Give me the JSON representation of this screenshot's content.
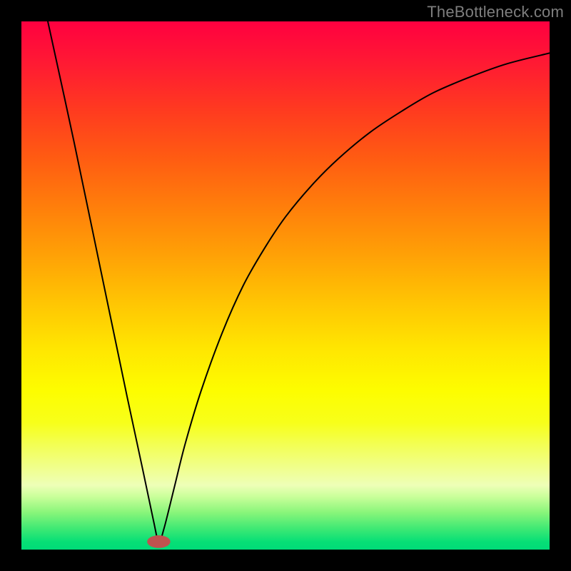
{
  "watermark": "TheBottleneck.com",
  "chart_data": {
    "type": "line",
    "title": "",
    "xlabel": "",
    "ylabel": "",
    "xlim": [
      0,
      100
    ],
    "ylim": [
      0,
      100
    ],
    "colors": {
      "top": "#ff0040",
      "bottom": "#00db78",
      "curve": "#000000",
      "marker": "#c0524f",
      "frame": "#000000"
    },
    "marker": {
      "x": 26,
      "y": 1.5,
      "rx": 2.2,
      "ry": 1.2
    },
    "series": [
      {
        "name": "curve",
        "x": [
          5,
          10,
          15,
          20,
          23,
          25,
          26,
          27,
          29,
          31,
          34,
          38,
          42,
          46,
          50,
          55,
          60,
          66,
          72,
          78,
          85,
          92,
          100
        ],
        "y": [
          100,
          77,
          53,
          29,
          15,
          5.5,
          1.5,
          4,
          12,
          20,
          30,
          41,
          50,
          57,
          63,
          69,
          74,
          79,
          83,
          86.5,
          89.5,
          92,
          94
        ]
      }
    ]
  }
}
